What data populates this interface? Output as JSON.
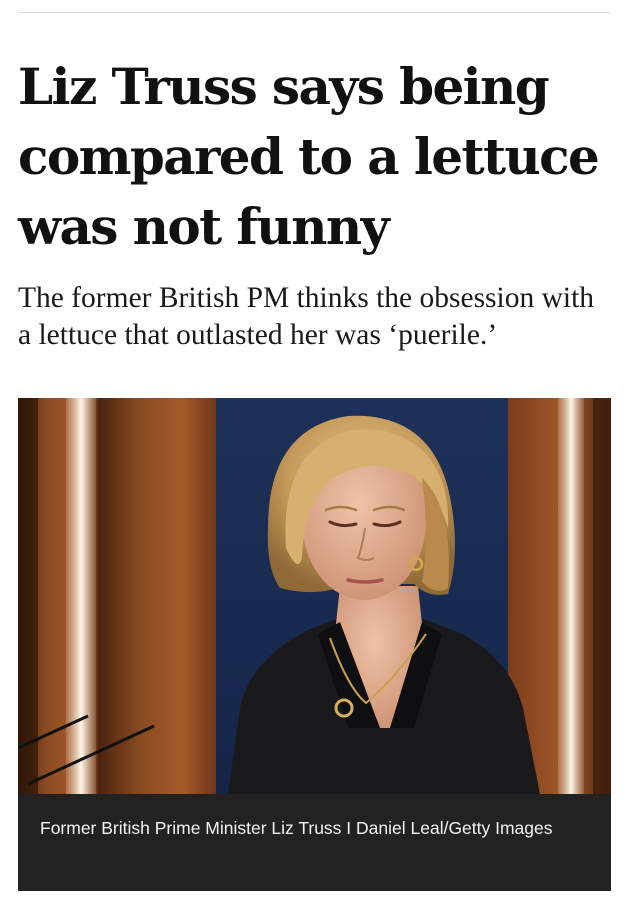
{
  "article": {
    "headline": "Liz Truss says being compared to a lettuce was not funny",
    "standfirst": "The former British PM thinks the obsession with a lettuce that outlasted her was ‘puerile.’",
    "image": {
      "caption": "Former British Prime Minister Liz Truss I Daniel Leal/Getty Images"
    }
  }
}
